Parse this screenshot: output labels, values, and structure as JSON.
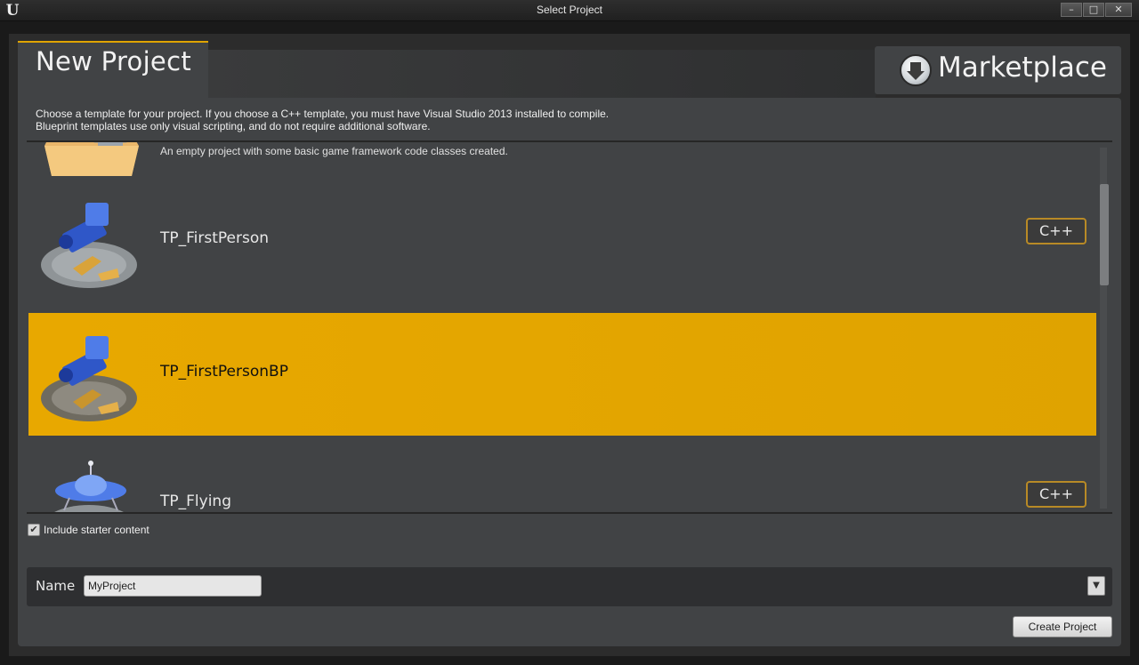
{
  "window": {
    "title": "Select Project",
    "minimize": "–",
    "maximize": "□",
    "close": "✕"
  },
  "tabs": {
    "new_project": "New Project",
    "marketplace": "Marketplace"
  },
  "description": {
    "line1": "Choose a template for your project. If you choose a C++ template, you must have Visual Studio 2013 installed to compile.",
    "line2": "Blueprint templates use only visual scripting, and do not require additional software."
  },
  "templates": [
    {
      "name": "",
      "description": "An empty project with some basic game framework code classes created.",
      "badge": "",
      "selected": false
    },
    {
      "name": "TP_FirstPerson",
      "badge": "C++",
      "selected": false
    },
    {
      "name": "TP_FirstPersonBP",
      "badge": "",
      "selected": true
    },
    {
      "name": "TP_Flying",
      "badge": "C++",
      "selected": false
    }
  ],
  "starter": {
    "checked": true,
    "check_glyph": "✔",
    "label": "Include starter content"
  },
  "name_field": {
    "label": "Name",
    "value": "MyProject"
  },
  "dropdown_glyph": "▼",
  "create_button": "Create Project",
  "colors": {
    "accent": "#e0a400",
    "panel": "#414345",
    "badge_border": "#b88a26"
  }
}
